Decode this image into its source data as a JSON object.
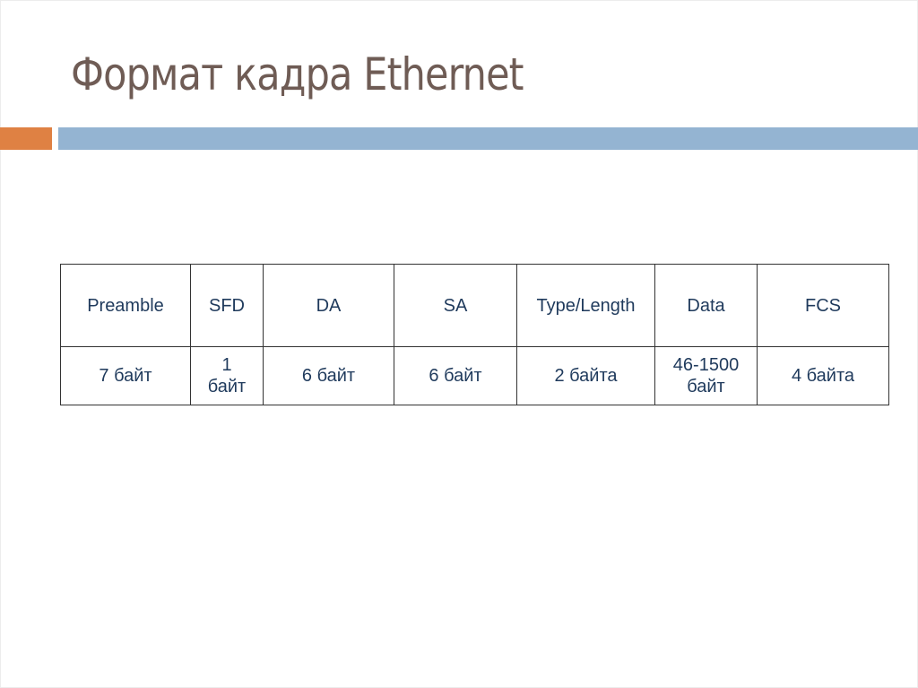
{
  "slide": {
    "title": "Формат кадра Ethernet",
    "accent_colors": {
      "title": "#6f5c55",
      "orange_bar": "#df8143",
      "blue_bar": "#94b4d2",
      "table_text": "#1f3a5c"
    }
  },
  "table": {
    "fields": [
      {
        "name": "Preamble",
        "size_line1": "7 байт",
        "size_line2": ""
      },
      {
        "name": "SFD",
        "size_line1": "1",
        "size_line2": "байт"
      },
      {
        "name": "DA",
        "size_line1": "6 байт",
        "size_line2": ""
      },
      {
        "name": "SA",
        "size_line1": "6 байт",
        "size_line2": ""
      },
      {
        "name": "Type/Length",
        "size_line1": "2 байта",
        "size_line2": ""
      },
      {
        "name": "Data",
        "size_line1": "46-1500",
        "size_line2": "байт"
      },
      {
        "name": "FCS",
        "size_line1": "4 байта",
        "size_line2": ""
      }
    ]
  }
}
